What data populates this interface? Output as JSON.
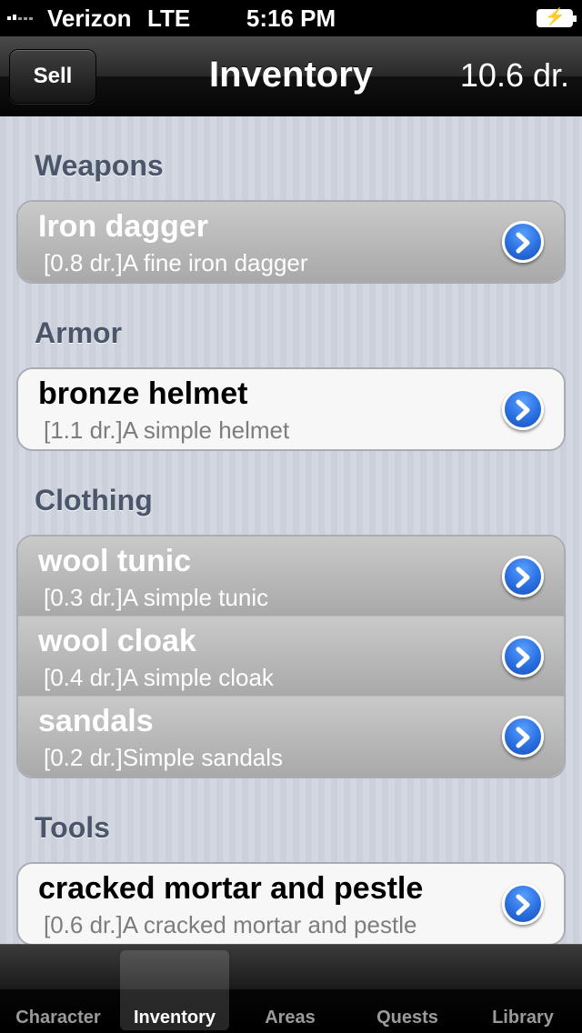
{
  "status_bar": {
    "carrier": "Verizon",
    "network": "LTE",
    "time": "5:16 PM"
  },
  "nav": {
    "left_button": "Sell",
    "title": "Inventory",
    "balance": "10.6 dr."
  },
  "sections": [
    {
      "header": "Weapons",
      "items": [
        {
          "name": "Iron dagger",
          "detail": "[0.8 dr.]A fine iron dagger",
          "selected": true
        }
      ]
    },
    {
      "header": "Armor",
      "items": [
        {
          "name": "bronze helmet",
          "detail": "[1.1 dr.]A simple helmet",
          "selected": false
        }
      ]
    },
    {
      "header": "Clothing",
      "items": [
        {
          "name": "wool tunic",
          "detail": "[0.3 dr.]A simple tunic",
          "selected": true
        },
        {
          "name": "wool cloak",
          "detail": "[0.4 dr.]A simple cloak",
          "selected": true
        },
        {
          "name": "sandals",
          "detail": "[0.2 dr.]Simple sandals",
          "selected": true
        }
      ]
    },
    {
      "header": "Tools",
      "items": [
        {
          "name": "cracked mortar and pestle",
          "detail": "[0.6 dr.]A cracked mortar and pestle",
          "selected": false
        }
      ]
    }
  ],
  "tabs": [
    {
      "label": "Character",
      "active": false
    },
    {
      "label": "Inventory",
      "active": true
    },
    {
      "label": "Areas",
      "active": false
    },
    {
      "label": "Quests",
      "active": false
    },
    {
      "label": "Library",
      "active": false
    }
  ],
  "icons": {
    "disclosure": "blue-chevron-right-icon"
  },
  "colors": {
    "section_header": "#4c566a",
    "disclosure_blue": "#2a6fe0"
  }
}
